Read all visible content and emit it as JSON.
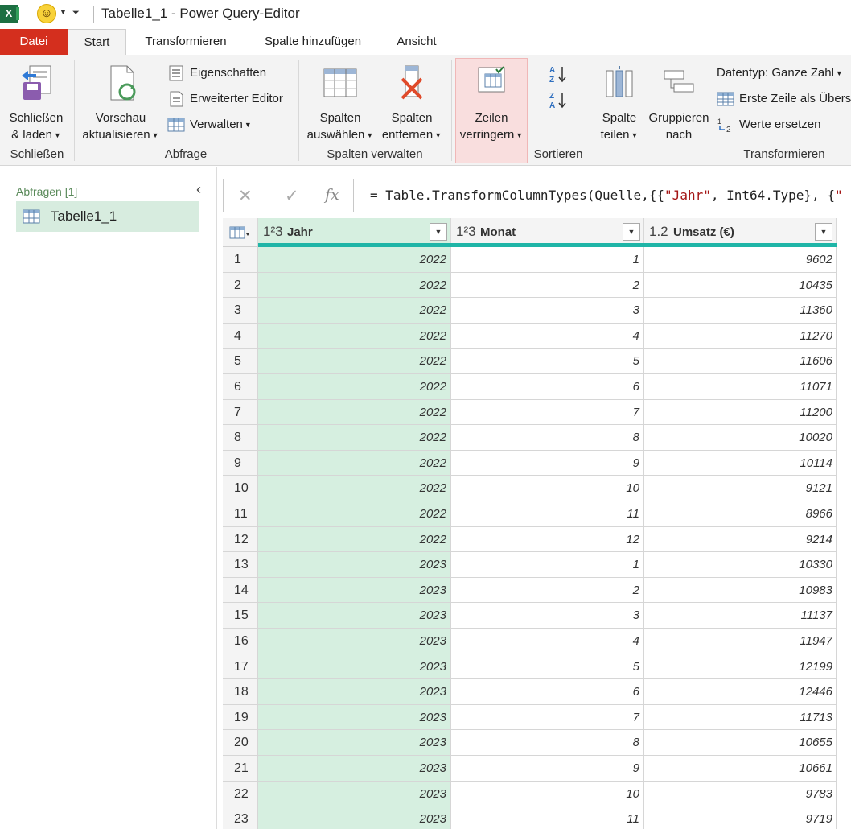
{
  "window": {
    "title": "Tabelle1_1 - Power Query-Editor",
    "app_icon_letter": "X"
  },
  "tabs": [
    {
      "label": "Datei"
    },
    {
      "label": "Start"
    },
    {
      "label": "Transformieren"
    },
    {
      "label": "Spalte hinzufügen"
    },
    {
      "label": "Ansicht"
    }
  ],
  "ribbon": {
    "close_load": {
      "line1": "Schließen",
      "line2": "& laden"
    },
    "preview": {
      "line1": "Vorschau",
      "line2": "aktualisieren"
    },
    "properties": "Eigenschaften",
    "advanced_editor": "Erweiterter Editor",
    "manage": "Verwalten",
    "choose_cols": {
      "line1": "Spalten",
      "line2": "auswählen"
    },
    "remove_cols": {
      "line1": "Spalten",
      "line2": "entfernen"
    },
    "reduce_rows": {
      "line1": "Zeilen",
      "line2": "verringern"
    },
    "split_col": {
      "line1": "Spalte",
      "line2": "teilen"
    },
    "group_by": {
      "line1": "Gruppieren",
      "line2": "nach"
    },
    "datatype": "Datentyp: Ganze Zahl",
    "first_row_header": "Erste Zeile als Übers",
    "replace_values": "Werte ersetzen",
    "groups": {
      "close": "Schließen",
      "query": "Abfrage",
      "manage_cols": "Spalten verwalten",
      "sort": "Sortieren",
      "transform": "Transformieren"
    }
  },
  "queries": {
    "header": "Abfragen [1]",
    "items": [
      {
        "label": "Tabelle1_1"
      }
    ]
  },
  "formula_bar": {
    "prefix": "= Table.TransformColumnTypes(Quelle,{{",
    "str1": "\"Jahr\"",
    "mid": ", Int64.Type}, {",
    "str2": "\"",
    "fx": "fx"
  },
  "grid": {
    "columns": [
      {
        "type_icon": "1²3",
        "name": "Jahr"
      },
      {
        "type_icon": "1²3",
        "name": "Monat"
      },
      {
        "type_icon": "1.2",
        "name": "Umsatz (€)"
      }
    ],
    "rows": [
      {
        "idx": "1",
        "jahr": "2022",
        "monat": "1",
        "umsatz": "9602"
      },
      {
        "idx": "2",
        "jahr": "2022",
        "monat": "2",
        "umsatz": "10435"
      },
      {
        "idx": "3",
        "jahr": "2022",
        "monat": "3",
        "umsatz": "11360"
      },
      {
        "idx": "4",
        "jahr": "2022",
        "monat": "4",
        "umsatz": "11270"
      },
      {
        "idx": "5",
        "jahr": "2022",
        "monat": "5",
        "umsatz": "11606"
      },
      {
        "idx": "6",
        "jahr": "2022",
        "monat": "6",
        "umsatz": "11071"
      },
      {
        "idx": "7",
        "jahr": "2022",
        "monat": "7",
        "umsatz": "11200"
      },
      {
        "idx": "8",
        "jahr": "2022",
        "monat": "8",
        "umsatz": "10020"
      },
      {
        "idx": "9",
        "jahr": "2022",
        "monat": "9",
        "umsatz": "10114"
      },
      {
        "idx": "10",
        "jahr": "2022",
        "monat": "10",
        "umsatz": "9121"
      },
      {
        "idx": "11",
        "jahr": "2022",
        "monat": "11",
        "umsatz": "8966"
      },
      {
        "idx": "12",
        "jahr": "2022",
        "monat": "12",
        "umsatz": "9214"
      },
      {
        "idx": "13",
        "jahr": "2023",
        "monat": "1",
        "umsatz": "10330"
      },
      {
        "idx": "14",
        "jahr": "2023",
        "monat": "2",
        "umsatz": "10983"
      },
      {
        "idx": "15",
        "jahr": "2023",
        "monat": "3",
        "umsatz": "11137"
      },
      {
        "idx": "16",
        "jahr": "2023",
        "monat": "4",
        "umsatz": "11947"
      },
      {
        "idx": "17",
        "jahr": "2023",
        "monat": "5",
        "umsatz": "12199"
      },
      {
        "idx": "18",
        "jahr": "2023",
        "monat": "6",
        "umsatz": "12446"
      },
      {
        "idx": "19",
        "jahr": "2023",
        "monat": "7",
        "umsatz": "11713"
      },
      {
        "idx": "20",
        "jahr": "2023",
        "monat": "8",
        "umsatz": "10655"
      },
      {
        "idx": "21",
        "jahr": "2023",
        "monat": "9",
        "umsatz": "10661"
      },
      {
        "idx": "22",
        "jahr": "2023",
        "monat": "10",
        "umsatz": "9783"
      },
      {
        "idx": "23",
        "jahr": "2023",
        "monat": "11",
        "umsatz": "9719"
      }
    ]
  },
  "colors": {
    "file_tab": "#d42f1e",
    "selected_col": "#d6efe0",
    "quality_bar": "#1fb5a7"
  }
}
